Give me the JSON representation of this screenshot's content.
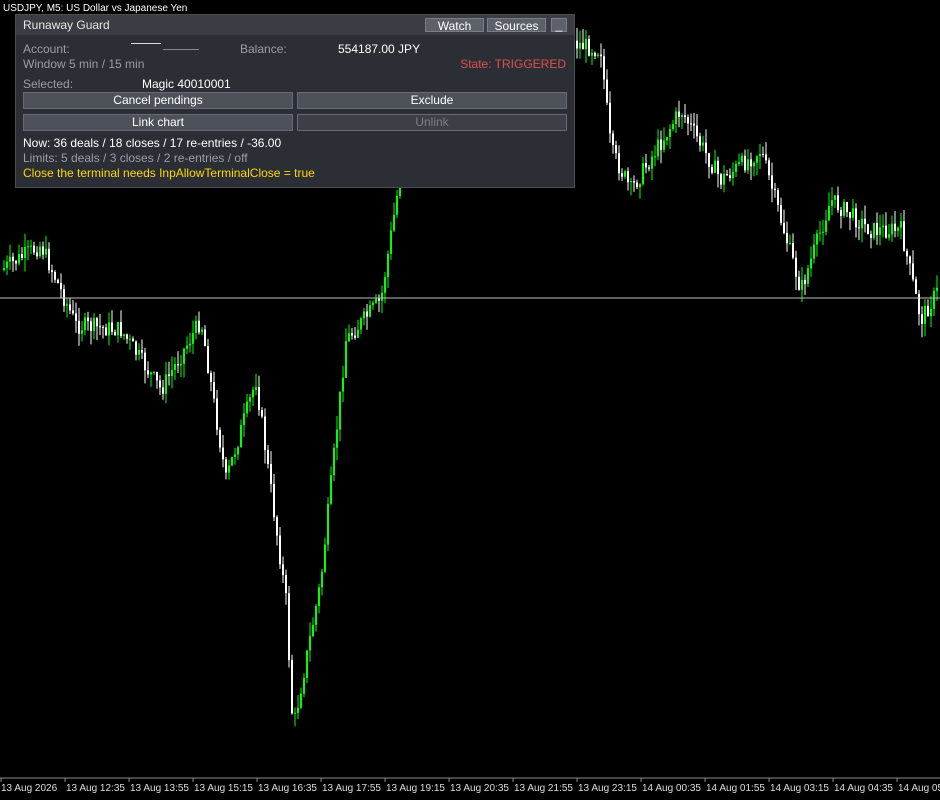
{
  "chart": {
    "symbol_caption": "USDJPY, M5:  US Dollar vs Japanese Yen",
    "time_labels": [
      "13 Aug 2026",
      "13 Aug 12:35",
      "13 Aug 13:55",
      "13 Aug 15:15",
      "13 Aug 16:35",
      "13 Aug 17:55",
      "13 Aug 19:15",
      "13 Aug 20:35",
      "13 Aug 21:55",
      "13 Aug 23:15",
      "14 Aug 00:35",
      "14 Aug 01:55",
      "14 Aug 03:15",
      "14 Aug 04:35",
      "14 Aug 05"
    ],
    "bull_color": "#00ff00",
    "bear_color": "#ffffff",
    "price_line_color": "#c0c0c0"
  },
  "panel": {
    "title": "Runaway Guard",
    "watch_label": "Watch",
    "sources_label": "Sources",
    "minimize_label": "_",
    "account_label": "Account:",
    "balance_label": "Balance:",
    "balance_value": "554187.00 JPY",
    "window_text": "Window 5 min / 15 min",
    "state_text": "State: TRIGGERED",
    "selected_label": "Selected:",
    "selected_value": "Magic 40010001",
    "cancel_pendings_label": "Cancel pendings",
    "exclude_label": "Exclude",
    "link_chart_label": "Link chart",
    "unlink_label": "Unlink",
    "now_text": "Now: 36 deals / 18 closes / 17 re-entries / -36.00",
    "limits_text": "Limits: 5 deals / 3 closes / 2 re-entries / off",
    "warning_text": "Close the terminal needs InpAllowTerminalClose = true",
    "state_color": "#e05050",
    "warning_color": "#ffd700"
  }
}
